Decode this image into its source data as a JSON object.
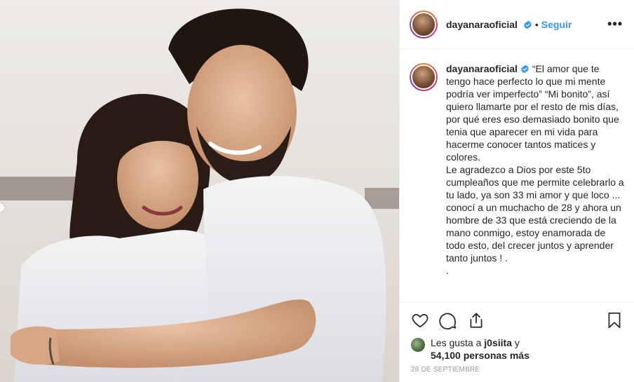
{
  "post": {
    "username": "dayanaraoficial",
    "follow_label": "Seguir",
    "more_label": "•••",
    "separator": "•",
    "caption": "“El amor que te tengo hace perfecto lo que mi mente podría ver imperfecto” “Mi bonito”, así quiero llamarte por el resto de mis días, por qué eres eso demasiado bonito que tenia que aparecer en mi vida para hacerme conocer tantos matices y colores.\nLe agradezco a Dios por este 5to cumpleaños que me permite celebrarlo a tu lado, ya son 33 mi amor y que loco ... conocí a un muchacho de 28 y ahora un hombre de 33 que está creciendo de la mano conmigo, estoy enamorada de todo esto, del crecer juntos y aprender tanto juntos ! .\n.",
    "likes_prefix": "Les gusta a ",
    "likes_user": "j0siita",
    "likes_connector": " y",
    "likes_count": "54,100 personas más",
    "date": "28 DE SEPTIEMBRE"
  },
  "icons": {
    "verified": "verified-badge-icon",
    "like": "heart-icon",
    "comment": "comment-icon",
    "share": "share-icon",
    "save": "bookmark-icon"
  },
  "colors": {
    "accent": "#3897f0",
    "text": "#262626",
    "muted": "#999999",
    "border": "#efefef"
  }
}
